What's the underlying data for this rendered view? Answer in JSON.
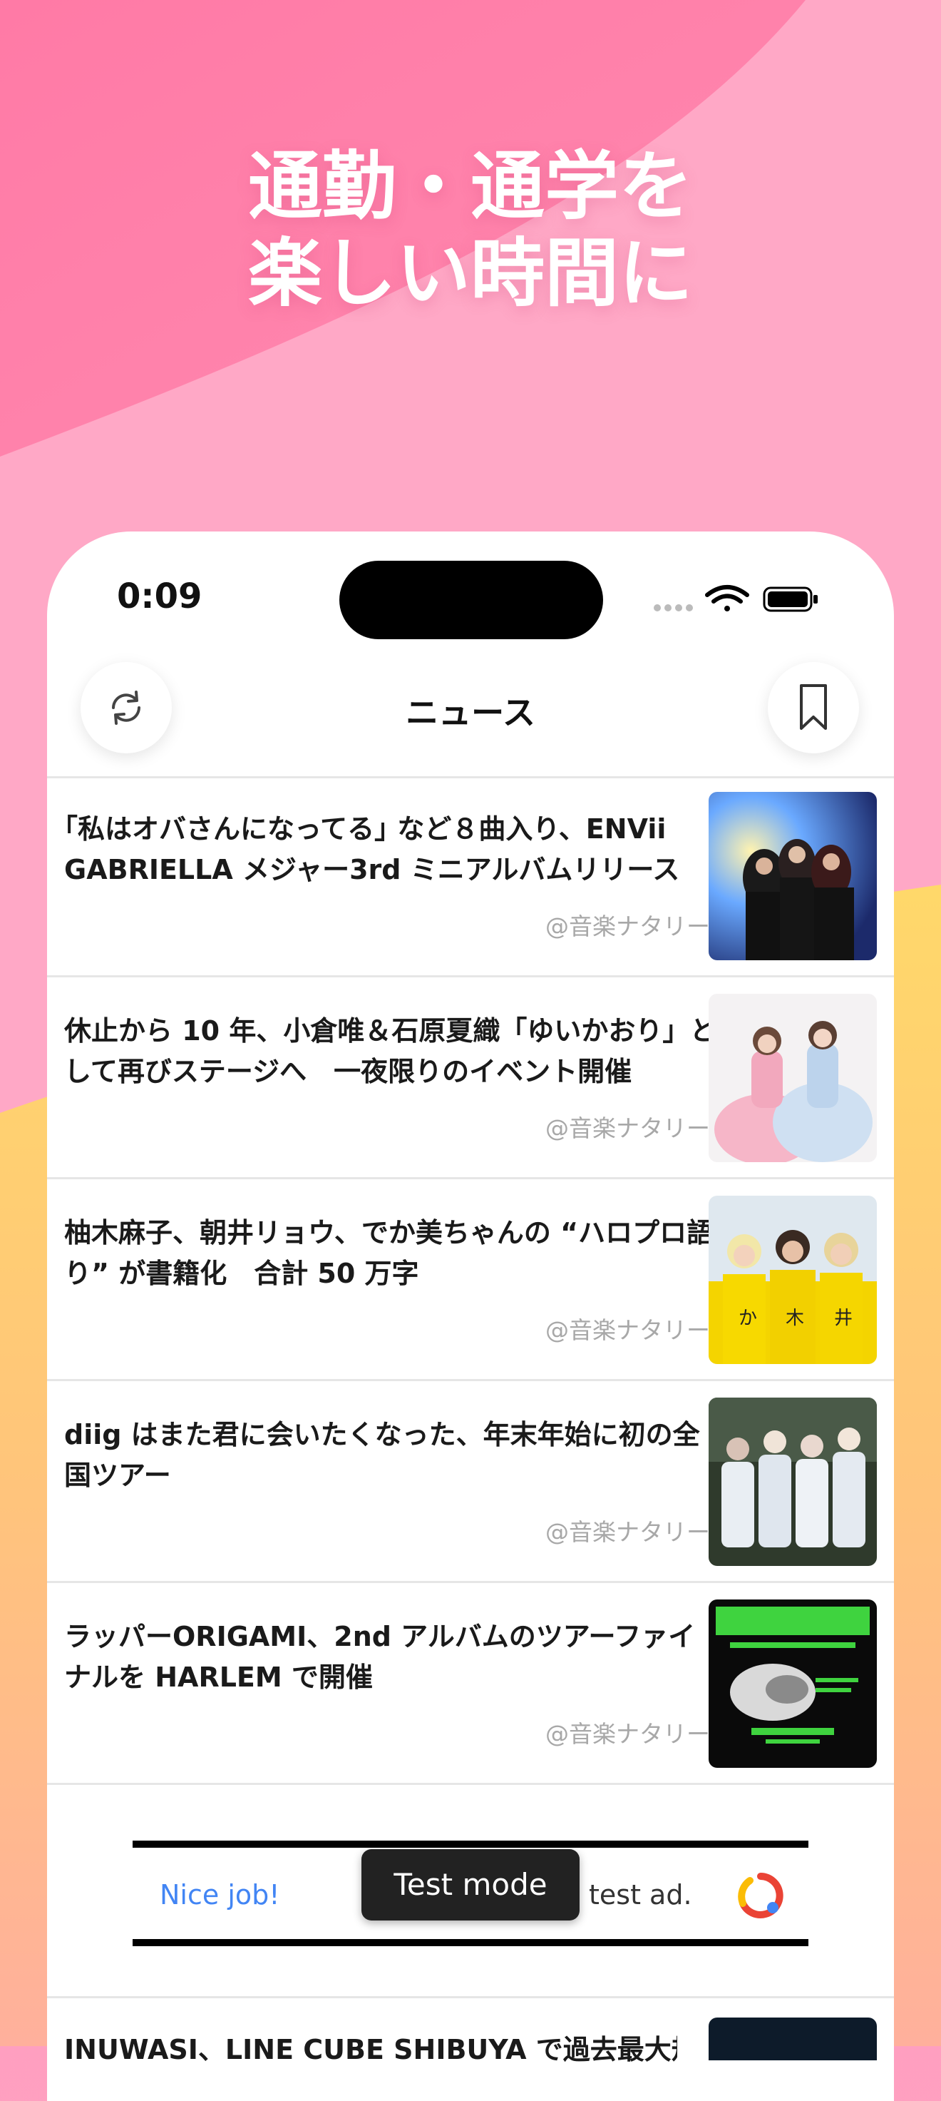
{
  "colors": {
    "pink_bg": "#ff9fc0",
    "pink_dark": "#ff7aa6",
    "yellow_bg": "#ffd36b",
    "peach_bg": "#ffb29b",
    "white": "#ffffff"
  },
  "promo": {
    "headline_line1": "通勤・通学を",
    "headline_line2": "楽しい時間に"
  },
  "status_bar": {
    "time": "0:09",
    "icons": [
      "cellular-icon",
      "wifi-icon",
      "battery-icon"
    ]
  },
  "top_bar": {
    "title": "ニュース",
    "left_icon": "refresh-icon",
    "right_icon": "bookmark-icon"
  },
  "articles": [
    {
      "title": "｢私はオバさんになってる｣ など８曲入り、ENVii GABRIELLA メジャー3rd ミニアルバムリリース",
      "source": "@音楽ナタリー"
    },
    {
      "title": "休止から 10 年、小倉唯＆石原夏織「ゆいかおり」として再びステージへ　一夜限りのイベント開催",
      "source": "@音楽ナタリー"
    },
    {
      "title": "柚木麻子、朝井リョウ、でか美ちゃんの “ハロプロ語り” が書籍化　合計 50 万字",
      "source": "@音楽ナタリー"
    },
    {
      "title": "diig はまた君に会いたくなった、年末年始に初の全国ツアー",
      "source": "@音楽ナタリー"
    },
    {
      "title": "ラッパーORIGAMI、2nd アルバムのツアーファイナルを HARLEM で開催",
      "source": "@音楽ナタリー"
    }
  ],
  "ad": {
    "left_text": "Nice job!",
    "right_text": "test ad.",
    "badge": "Test mode",
    "icon": "ad-logo-icon"
  },
  "partial_article": {
    "title": "INUWASI、LINE CUBE SHIBUYA で過去最大規"
  }
}
